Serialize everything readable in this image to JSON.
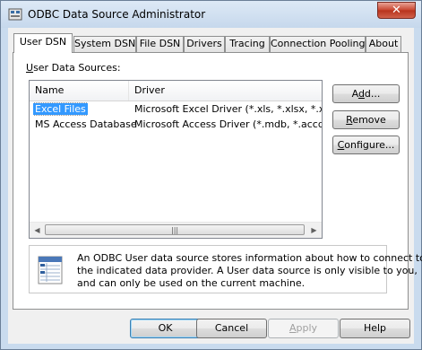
{
  "window": {
    "title": "ODBC Data Source Administrator",
    "close_glyph": "✕"
  },
  "tabs": [
    {
      "label": "User DSN",
      "active": true
    },
    {
      "label": "System DSN"
    },
    {
      "label": "File DSN"
    },
    {
      "label": "Drivers"
    },
    {
      "label": "Tracing"
    },
    {
      "label": "Connection Pooling"
    },
    {
      "label": "About"
    }
  ],
  "panel": {
    "list_label_prefix": "U",
    "list_label_rest": "ser Data Sources:",
    "columns": [
      "Name",
      "Driver"
    ],
    "rows": [
      {
        "name": "Excel Files",
        "driver": "Microsoft Excel Driver (*.xls, *.xlsx, *.xlsm, *.x",
        "selected": true
      },
      {
        "name": "MS Access Database",
        "driver": "Microsoft Access Driver (*.mdb, *.accdb)"
      }
    ],
    "scroll_left": "◀",
    "scroll_right": "▶",
    "scroll_grip": "|||"
  },
  "side_buttons": {
    "add_prefix": "A",
    "add_u": "d",
    "add_rest": "d...",
    "remove_u": "R",
    "remove_rest": "emove",
    "configure_prefix": "",
    "configure_u": "C",
    "configure_rest": "onfigure..."
  },
  "info": {
    "lines": [
      "An ODBC User data source stores information about how to connect to",
      "the indicated data provider.   A User data source is only visible to you,",
      "and can only be used on the current machine."
    ]
  },
  "bottom_buttons": {
    "ok": "OK",
    "cancel": "Cancel",
    "apply_u": "A",
    "apply_rest": "pply",
    "help": "Help"
  },
  "icons": {
    "app": "odbc-app-icon",
    "info": "database-table-icon",
    "close": "close-icon"
  }
}
